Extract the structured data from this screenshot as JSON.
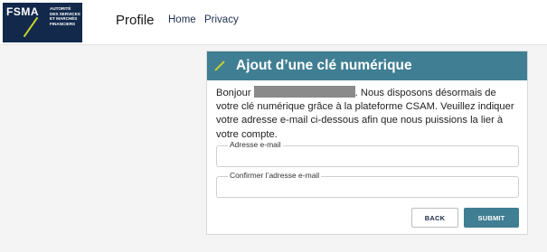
{
  "brand": {
    "logo_text": "FSMA",
    "logo_subtitle": "AUTORITÉ DES SERVICES ET MARCHÉS FINANCIERS"
  },
  "nav": {
    "profile": "Profile",
    "home": "Home",
    "privacy": "Privacy"
  },
  "card": {
    "title": "Ajout d’une clé numérique",
    "greeting": "Bonjour",
    "message": ". Nous disposons désormais de votre clé numérique grâce à la plateforme CSAM. Veuillez indiquer votre adresse e-mail ci-dessous afin que nous puissions la lier à votre compte.",
    "email_label": "Adresse e-mail",
    "email_value": "",
    "confirm_label": "Confirmer l’adresse e-mail",
    "confirm_value": "",
    "back_label": "BACK",
    "submit_label": "SUBMIT"
  },
  "colors": {
    "brand_navy": "#13294b",
    "accent_teal": "#3f7e93",
    "accent_lime": "#c8d42a"
  }
}
